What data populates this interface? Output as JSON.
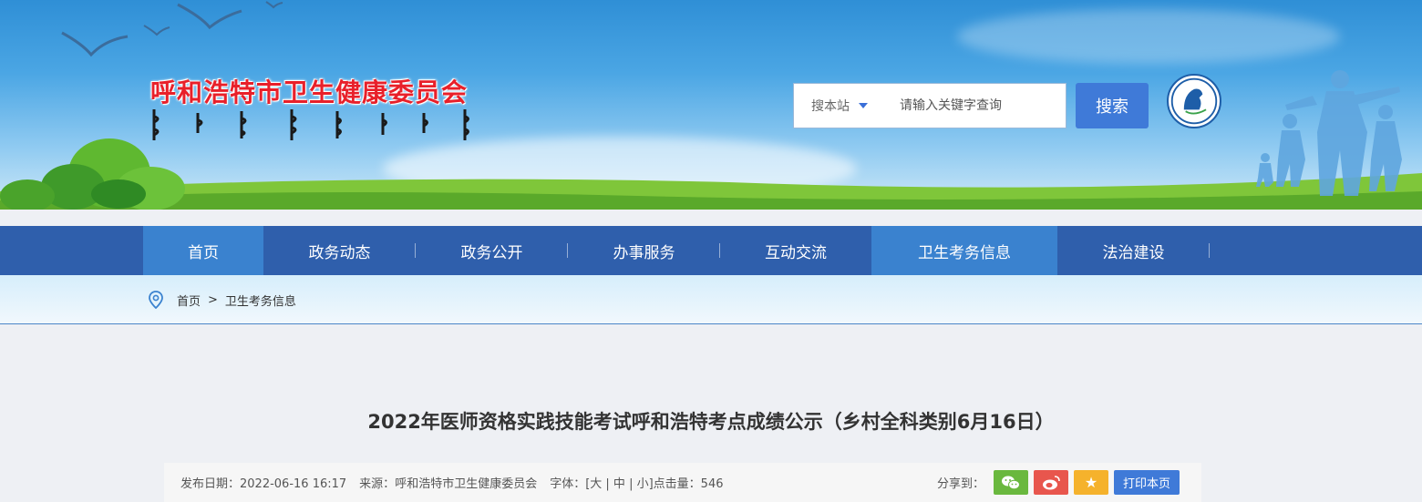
{
  "header": {
    "site_title": "呼和浩特市卫生健康委员会",
    "search_scope": "搜本站",
    "search_placeholder": "请输入关键字查询",
    "search_button": "搜索"
  },
  "nav": {
    "items": [
      {
        "label": "首页",
        "active": true
      },
      {
        "label": "政务动态",
        "active": false
      },
      {
        "label": "政务公开",
        "active": false
      },
      {
        "label": "办事服务",
        "active": false
      },
      {
        "label": "互动交流",
        "active": false
      },
      {
        "label": "卫生考务信息",
        "active": true
      },
      {
        "label": "法治建设",
        "active": false
      }
    ]
  },
  "breadcrumb": {
    "home": "首页",
    "separator": ">",
    "current": "卫生考务信息"
  },
  "article": {
    "title": "2022年医师资格实践技能考试呼和浩特考点成绩公示（乡村全科类别6月16日）",
    "publish_label": "发布日期：",
    "publish_date": "2022-06-16 16:17",
    "source_label": "来源：",
    "source": "呼和浩特市卫生健康委员会",
    "font_label": "字体：",
    "font_options": "[大 | 中 | 小]",
    "clicks_label": "点击量：",
    "clicks": "546",
    "share_label": "分享到：",
    "print_label": "打印本页"
  },
  "colors": {
    "nav_bg": "#2f5fac",
    "nav_active": "#3a82cf",
    "title_red": "#e8202a",
    "button_blue": "#3f7ad8"
  }
}
